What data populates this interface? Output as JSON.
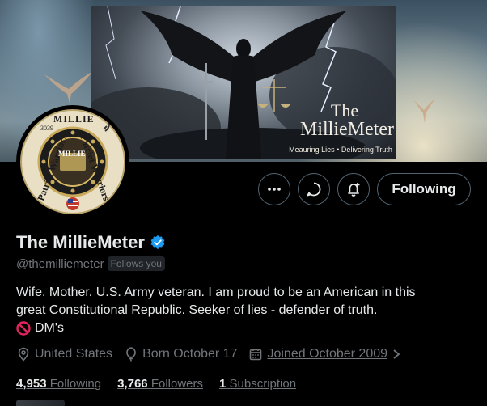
{
  "banner": {
    "title_the": "The",
    "title_name": "MillieMeter",
    "tagline": "Meauring Lies • Delivering Truth"
  },
  "avatar": {
    "ring_top": "MILLIE",
    "ring_left": "Patriot Warriors",
    "ring_right": "Patriot Warriors",
    "number": "3039",
    "center": "MILLIE"
  },
  "actions": {
    "more": "more-icon",
    "message": "message-icon",
    "notify": "bell-plus-icon",
    "following_label": "Following"
  },
  "profile": {
    "display_name": "The MillieMeter",
    "handle": "@themilliemeter",
    "follows_you": "Follows you",
    "bio_line1": "Wife. Mother. U.S. Army veteran. I am proud to be an American in this",
    "bio_line2": "great Constitutional Republic.  Seeker of lies - defender of truth.",
    "bio_line3": "DM's",
    "location": "United States",
    "birthday": "Born October 17",
    "joined": "Joined October 2009"
  },
  "stats": {
    "following_count": "4,953",
    "following_label": "Following",
    "followers_count": "3,766",
    "followers_label": "Followers",
    "subscriptions_count": "1",
    "subscriptions_label": "Subscription"
  },
  "colors": {
    "background": "#000000",
    "text_primary": "#e7e9ea",
    "text_secondary": "#71767b",
    "border": "#536471",
    "verified": "#1d9bf0",
    "no_entry": "#e0245e"
  }
}
